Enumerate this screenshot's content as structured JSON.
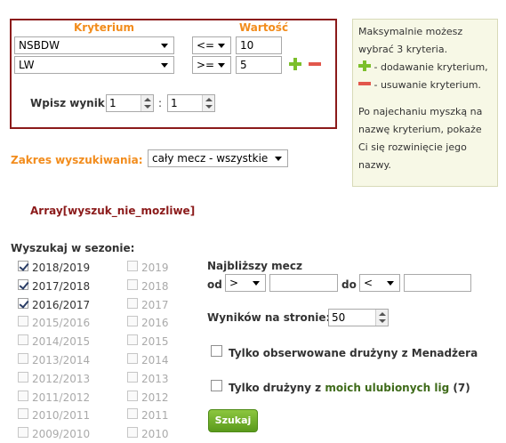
{
  "criteria": {
    "header_criterion": "Kryterium",
    "header_value": "Wartość",
    "rows": [
      {
        "criterion": "NSBDW",
        "operator": "<=",
        "value": "10"
      },
      {
        "criterion": "LW",
        "operator": ">=",
        "value": "5"
      }
    ],
    "result_label": "Wpisz wynik",
    "result_home": "1",
    "result_sep": ":",
    "result_away": "1"
  },
  "info": {
    "line1": "Maksymalnie możesz wybrać 3 kryteria.",
    "add_text": " - dodawanie kryterium,",
    "remove_text": " - usuwanie kryterium.",
    "hover_text": "Po najechaniu myszką na nazwę kryterium, pokaże Ci się rozwinięcie jego nazwy."
  },
  "scope": {
    "label": "Zakres wyszukiwania:",
    "selected": "cały mecz - wszystkie"
  },
  "error_text": "Array[wyszuk_nie_mozliwe]",
  "seasons": {
    "title": "Wyszukaj w sezonie:",
    "left": [
      {
        "label": "2018/2019",
        "checked": true
      },
      {
        "label": "2017/2018",
        "checked": true
      },
      {
        "label": "2016/2017",
        "checked": true
      },
      {
        "label": "2015/2016",
        "checked": false
      },
      {
        "label": "2014/2015",
        "checked": false
      },
      {
        "label": "2013/2014",
        "checked": false
      },
      {
        "label": "2012/2013",
        "checked": false
      },
      {
        "label": "2011/2012",
        "checked": false
      },
      {
        "label": "2010/2011",
        "checked": false
      },
      {
        "label": "2009/2010",
        "checked": false
      }
    ],
    "right": [
      {
        "label": "2019",
        "checked": false
      },
      {
        "label": "2018",
        "checked": false
      },
      {
        "label": "2017",
        "checked": false
      },
      {
        "label": "2016",
        "checked": false
      },
      {
        "label": "2015",
        "checked": false
      },
      {
        "label": "2014",
        "checked": false
      },
      {
        "label": "2013",
        "checked": false
      },
      {
        "label": "2012",
        "checked": false
      },
      {
        "label": "2011",
        "checked": false
      },
      {
        "label": "2010",
        "checked": false
      }
    ]
  },
  "nearest": {
    "title": "Najbliższy mecz",
    "from_label": "od",
    "from_op": ">",
    "from_value": "",
    "to_label": "do",
    "to_op": "<",
    "to_value": ""
  },
  "results_per_page": {
    "label": "Wyników na stronie:",
    "value": "50"
  },
  "watched_only": {
    "label": "Tylko obserwowane drużyny z Menadżera"
  },
  "favorite_only": {
    "label_prefix": "Tylko drużyny z ",
    "label_link": "moich ulubionych lig",
    "label_count": " (7)"
  },
  "search_button": "Szukaj",
  "colors": {
    "accent_orange": "#f28c1c",
    "border_red": "#8b1a1a",
    "error_red": "#8b1a1a",
    "green": "#5a9a1c",
    "link_green": "#3f6b1a"
  }
}
